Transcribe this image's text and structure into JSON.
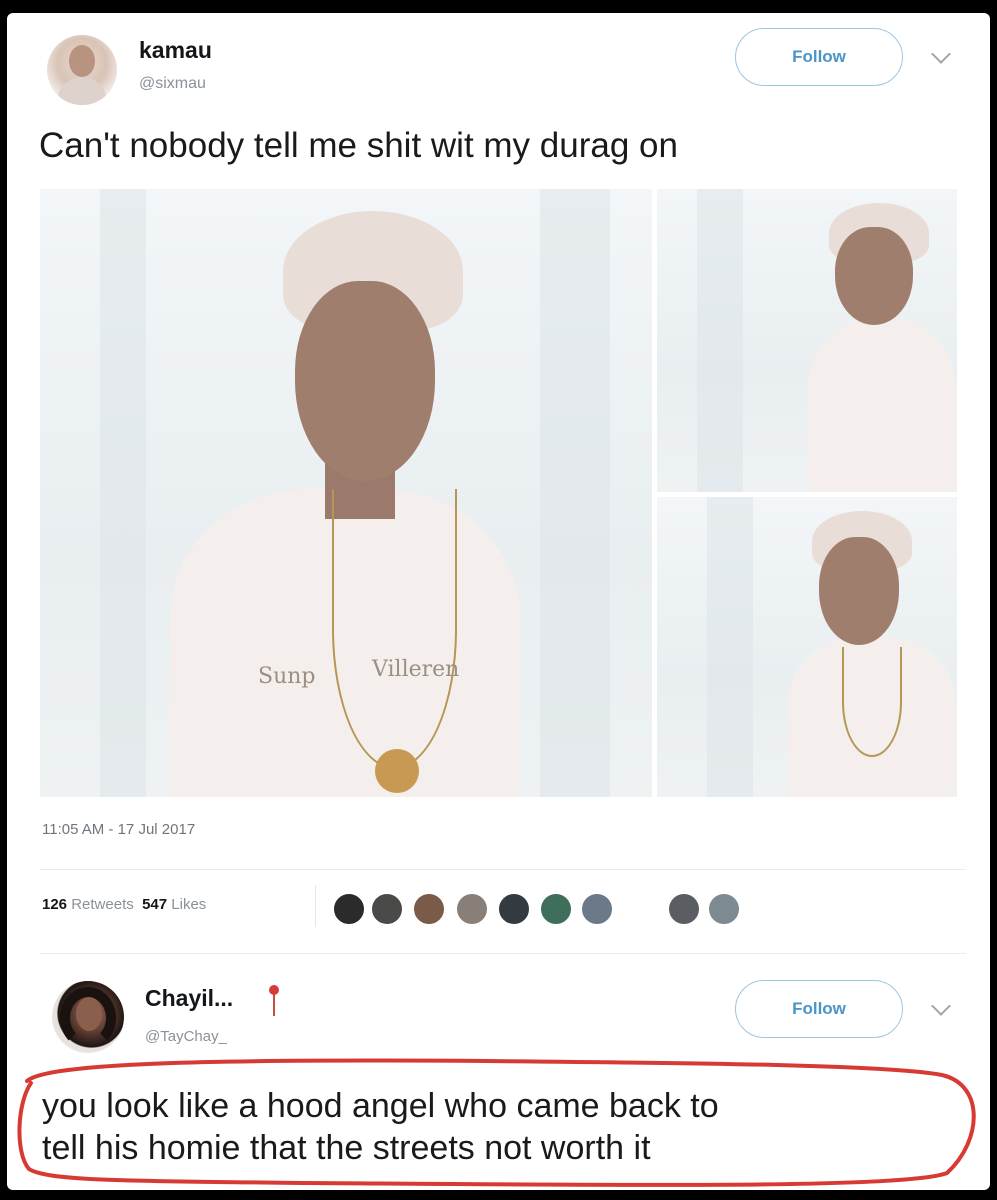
{
  "tweet": {
    "display_name": "kamau",
    "handle": "@sixmau",
    "follow_label": "Follow",
    "text": "Can't nobody tell me shit wit my durag on",
    "photo_shirt_text_left": "Sunp",
    "photo_shirt_text_right": "Villeren",
    "timestamp": "11:05 AM - 17 Jul 2017",
    "retweets_count": "126",
    "retweets_label": "Retweets",
    "likes_count": "547",
    "likes_label": "Likes",
    "liker_avatar_colors": [
      "#2b2b2b",
      "#4a4a48",
      "#7a5a48",
      "#8a7f76",
      "#333a40",
      "#3f6f5a",
      "#6a7a88",
      "#5a5e62",
      "#7d8a92"
    ]
  },
  "reply": {
    "display_name": "Chayil...",
    "handle": "@TayChay_",
    "follow_label": "Follow",
    "emoji_icon": "pushpin-icon",
    "text_line1": "you look like a hood angel who came back to",
    "text_line2": "tell his homie that the streets not worth it",
    "highlight_color": "#d63a33"
  },
  "colors": {
    "follow_text": "#4a95c8",
    "follow_border": "#9ec5e2"
  }
}
